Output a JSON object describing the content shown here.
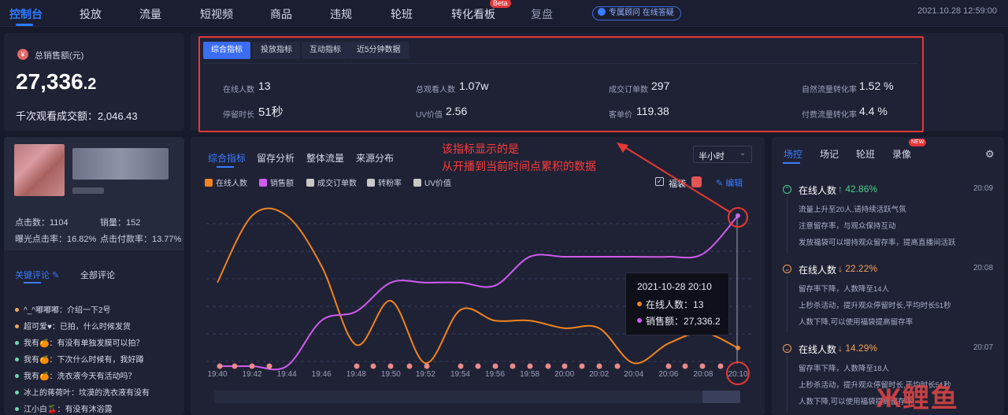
{
  "nav": {
    "items": [
      "控制台",
      "投放",
      "流量",
      "短视频",
      "商品",
      "违规",
      "轮班",
      "转化看板",
      "复盘"
    ],
    "beta": "Beta",
    "consult": "专属顾问 在线答疑",
    "datetime": "2021.10.28 12:59:00"
  },
  "sales": {
    "label": "总销售额(元)",
    "value_main": "27,336",
    "value_dec": ".2",
    "gpm_label": "千次观看成交额：",
    "gpm_value": "2,046.43"
  },
  "metric_tabs": [
    "综合指标",
    "投放指标",
    "互动指标",
    "近5分钟数据"
  ],
  "metrics": [
    {
      "label": "在线人数",
      "value": "13"
    },
    {
      "label": "总观看人数",
      "value": "1.07w"
    },
    {
      "label": "成交订单数",
      "value": "297"
    },
    {
      "label": "自然流量转化率",
      "value": "1.52 %"
    },
    {
      "label": "停留时长",
      "value": "51秒"
    },
    {
      "label": "UV价值",
      "value": "2.56"
    },
    {
      "label": "客单价",
      "value": "119.38"
    },
    {
      "label": "付费流量转化率",
      "value": "4.4 %"
    }
  ],
  "product": {
    "clicks_label": "点击数：",
    "clicks": "1104",
    "sales_label": "销量：",
    "sales": "152",
    "ctr_label": "曝光点击率：",
    "ctr": "16.82%",
    "cvr_label": "点击付款率：",
    "cvr": "13.77%"
  },
  "comment_tabs": [
    "关键评论",
    "全部评论"
  ],
  "comments": [
    {
      "user": "^_^嘟嘟嘟：",
      "text": "介绍一下2号",
      "color": "#f0a95a"
    },
    {
      "user": "超可爱♥：",
      "text": "已拍，什么时候发货",
      "color": "#f0a95a"
    },
    {
      "user": "我有🍊：",
      "text": "有没有单独发膜可以拍？",
      "color": "#6fd6b5"
    },
    {
      "user": "我有🍊：",
      "text": "下次什么时候有，我好蹲",
      "color": "#6fd6b5"
    },
    {
      "user": "我有🍊：",
      "text": "洗衣液今天有活动吗？",
      "color": "#6fd6b5"
    },
    {
      "user": "冰上的蒋荷叶：",
      "text": "坟漠的洗衣液有没有",
      "color": "#6fd6b5"
    },
    {
      "user": "江小白🍒：",
      "text": "有没有沐浴露",
      "color": "#6fd6b5"
    }
  ],
  "chart_tabs": [
    "综合指标",
    "留存分析",
    "整体流量",
    "来源分布"
  ],
  "interval": "半小时",
  "welfare": "福袋",
  "edit": "编辑",
  "annotation": [
    "该指标显示的是",
    "从开播到当前时间点累积的数据"
  ],
  "tooltip": {
    "time": "2021-10-28 20:10",
    "online_label": "在线人数：",
    "online": "13",
    "sales_label": "销售额：",
    "sales": "27,336.2"
  },
  "chart_data": {
    "type": "line",
    "x": [
      "19:40",
      "19:42",
      "19:44",
      "19:46",
      "19:48",
      "19:50",
      "19:52",
      "19:54",
      "19:56",
      "19:58",
      "20:00",
      "20:02",
      "20:04",
      "20:06",
      "20:08",
      "20:10"
    ],
    "legend": [
      "在线人数",
      "销售额",
      "成交订单数",
      "转粉率",
      "UV价值"
    ],
    "colors": {
      "在线人数": "#f0831f",
      "销售额": "#d05bf0",
      "成交订单数": "#c8c8c8",
      "转粉率": "#c8c8c8",
      "UV价值": "#c8c8c8"
    },
    "series": [
      {
        "name": "在线人数",
        "values": [
          0.55,
          0.99,
          0.99,
          0.66,
          0.14,
          0.43,
          0.02,
          0.37,
          0.3,
          0.3,
          0.25,
          0.25,
          0.02,
          0.15,
          0.22,
          0.12
        ]
      },
      {
        "name": "销售额",
        "values": [
          0.0,
          0.0,
          0.0,
          0.3,
          0.36,
          0.55,
          0.55,
          0.55,
          0.53,
          0.72,
          0.72,
          0.72,
          0.72,
          0.72,
          0.74,
          0.99
        ]
      }
    ],
    "value_scale": "relative",
    "grid": true
  },
  "right_tabs": [
    "场控",
    "场记",
    "轮班",
    "录像"
  ],
  "new_badge": "NEW",
  "events": [
    {
      "title": "在线人数",
      "dir": "up",
      "pct": "↑ 42.86%",
      "time": "20:09",
      "lines": [
        "流量上升至20人,请持续活跃气氛",
        "注意留存率，与观众保持互动",
        "发放福袋可以增持观众留存率，提高直播间活跃"
      ]
    },
    {
      "title": "在线人数",
      "dir": "down",
      "pct": "↓ 22.22%",
      "time": "20:08",
      "lines": [
        "留存率下降，人数降至14人",
        "上秒杀活动，提升观众停留时长,平均时长51秒",
        "人数下降,可以使用福袋提高留存率"
      ]
    },
    {
      "title": "在线人数",
      "dir": "down",
      "pct": "↓ 14.29%",
      "time": "20:07",
      "lines": [
        "留存率下降，人数降至18人",
        "上秒杀活动，提升观众停留时长,平均时长51秒",
        "人数下降,可以使用福袋提高留存率"
      ]
    }
  ],
  "watermark": "鲤鱼"
}
